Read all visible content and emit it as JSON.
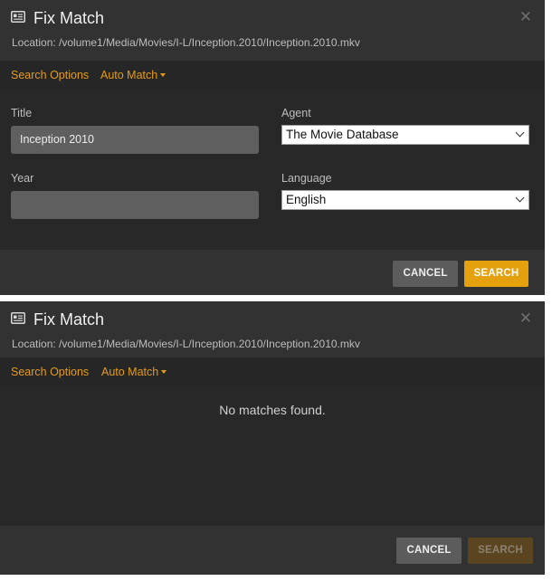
{
  "dialogs": [
    {
      "title": "Fix Match",
      "location": "Location: /volume1/Media/Movies/I-L/Inception.2010/Inception.2010.mkv",
      "tabs": {
        "search_options": "Search Options",
        "auto_match": "Auto Match"
      },
      "form": {
        "title_label": "Title",
        "title_value": "Inception 2010",
        "year_label": "Year",
        "year_value": "",
        "agent_label": "Agent",
        "agent_value": "The Movie Database",
        "language_label": "Language",
        "language_value": "English"
      },
      "buttons": {
        "cancel": "CANCEL",
        "search": "SEARCH"
      }
    },
    {
      "title": "Fix Match",
      "location": "Location: /volume1/Media/Movies/I-L/Inception.2010/Inception.2010.mkv",
      "tabs": {
        "search_options": "Search Options",
        "auto_match": "Auto Match"
      },
      "message": "No matches found.",
      "buttons": {
        "cancel": "CANCEL",
        "search": "SEARCH"
      }
    }
  ],
  "icons": {
    "header": "card-icon",
    "close": "close-icon",
    "dropdown": "caret-down-icon"
  },
  "colors": {
    "accent": "#e5a00d",
    "background": "#323232",
    "panel": "#282828"
  }
}
